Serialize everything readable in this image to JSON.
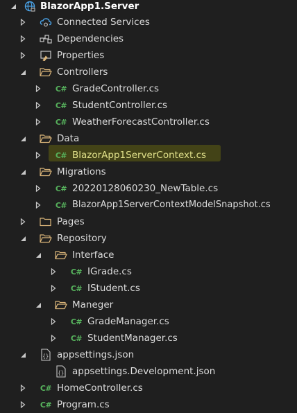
{
  "project": {
    "name": "BlazorApp1.Server"
  },
  "items": [
    {
      "label": "Connected Services",
      "icon": "connected-services-icon",
      "expander": "collapsed"
    },
    {
      "label": "Dependencies",
      "icon": "dependencies-icon",
      "expander": "collapsed"
    },
    {
      "label": "Properties",
      "icon": "properties-icon",
      "expander": "collapsed"
    },
    {
      "label": "Controllers",
      "icon": "folder-open-icon",
      "expander": "expanded"
    },
    {
      "label": "GradeController.cs",
      "icon": "csharp-file-icon",
      "expander": "collapsed"
    },
    {
      "label": "StudentController.cs",
      "icon": "csharp-file-icon",
      "expander": "collapsed"
    },
    {
      "label": "WeatherForecastController.cs",
      "icon": "csharp-file-icon",
      "expander": "collapsed"
    },
    {
      "label": "Data",
      "icon": "folder-open-icon",
      "expander": "expanded"
    },
    {
      "label": "BlazorApp1ServerContext.cs",
      "icon": "csharp-file-icon",
      "expander": "collapsed"
    },
    {
      "label": "Migrations",
      "icon": "folder-open-icon",
      "expander": "expanded"
    },
    {
      "label": "20220128060230_NewTable.cs",
      "icon": "csharp-file-icon",
      "expander": "collapsed"
    },
    {
      "label": "BlazorApp1ServerContextModelSnapshot.cs",
      "icon": "csharp-file-icon",
      "expander": "collapsed"
    },
    {
      "label": "Pages",
      "icon": "folder-icon",
      "expander": "collapsed"
    },
    {
      "label": "Repository",
      "icon": "folder-open-icon",
      "expander": "expanded"
    },
    {
      "label": "Interface",
      "icon": "folder-open-icon",
      "expander": "expanded"
    },
    {
      "label": "IGrade.cs",
      "icon": "csharp-file-icon",
      "expander": "collapsed"
    },
    {
      "label": "IStudent.cs",
      "icon": "csharp-file-icon",
      "expander": "collapsed"
    },
    {
      "label": "Maneger",
      "icon": "folder-open-icon",
      "expander": "expanded"
    },
    {
      "label": "GradeManager.cs",
      "icon": "csharp-file-icon",
      "expander": "collapsed"
    },
    {
      "label": "StudentManager.cs",
      "icon": "csharp-file-icon",
      "expander": "collapsed"
    },
    {
      "label": "appsettings.json",
      "icon": "json-file-icon",
      "expander": "expanded"
    },
    {
      "label": "appsettings.Development.json",
      "icon": "json-file-icon",
      "expander": "none"
    },
    {
      "label": "HomeController.cs",
      "icon": "csharp-file-icon",
      "expander": "collapsed"
    },
    {
      "label": "Program.cs",
      "icon": "csharp-file-icon",
      "expander": "collapsed"
    }
  ],
  "highlighted_item": "BlazorApp1ServerContext.cs",
  "colors": {
    "background": "#1f1f1f",
    "text": "#dcdcdc",
    "csharp": "#57b35d",
    "folder": "#dcb67a",
    "highlight": "#4a4a16"
  }
}
